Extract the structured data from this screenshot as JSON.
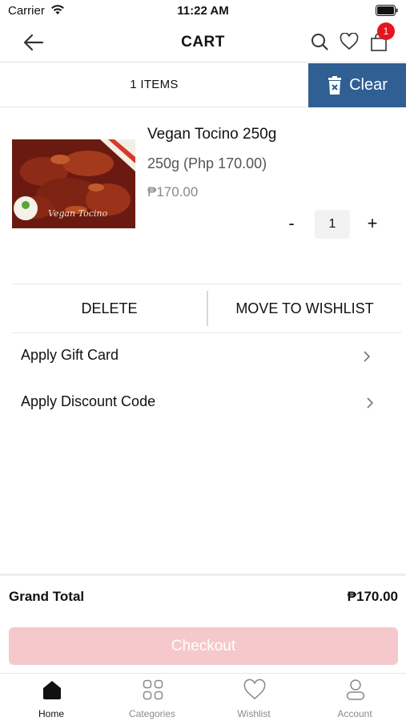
{
  "status_bar": {
    "carrier": "Carrier",
    "time": "11:22 AM"
  },
  "header": {
    "title": "CART",
    "cart_badge": "1"
  },
  "items_bar": {
    "count": "1 ITEMS",
    "clear_label": "Clear"
  },
  "cart_item": {
    "name": "Vegan Tocino 250g",
    "variant": "250g (Php 170.00)",
    "price": "₱170.00",
    "quantity": "1",
    "minus": "-",
    "plus": "+"
  },
  "actions": {
    "delete_label": "DELETE",
    "wishlist_label": "MOVE TO WISHLIST"
  },
  "options": [
    {
      "label": "Apply Gift Card"
    },
    {
      "label": "Apply Discount Code"
    }
  ],
  "summary": {
    "grand_total_label": "Grand Total",
    "grand_total_value": "₱170.00",
    "checkout_label": "Checkout"
  },
  "tabs": [
    {
      "label": "Home",
      "icon": "home-icon"
    },
    {
      "label": "Categories",
      "icon": "grid-icon"
    },
    {
      "label": "Wishlist",
      "icon": "heart-icon"
    },
    {
      "label": "Account",
      "icon": "user-icon"
    }
  ],
  "colors": {
    "accent_blue": "#2f5f93",
    "badge_red": "#e5161f",
    "checkout_disabled": "#f5c9cc"
  }
}
